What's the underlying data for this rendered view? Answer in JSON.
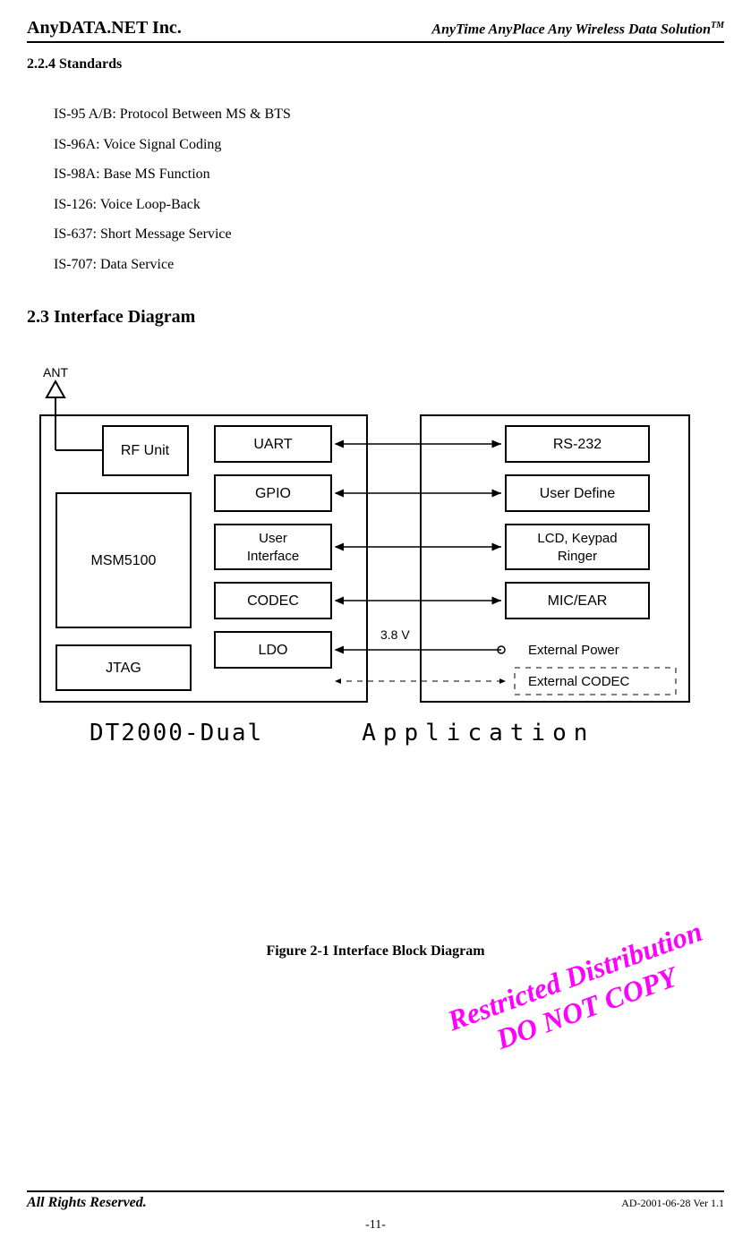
{
  "header": {
    "company": "AnyDATA.NET Inc.",
    "tagline": "AnyTime AnyPlace Any Wireless Data Solution",
    "tagline_super": "TM"
  },
  "section": {
    "number_title": "2.2.4 Standards",
    "standards": [
      "IS-95 A/B: Protocol Between MS & BTS",
      "IS-96A: Voice Signal Coding",
      "IS-98A: Base MS Function",
      "IS-126: Voice Loop-Back",
      "IS-637: Short Message Service",
      "IS-707: Data Service"
    ]
  },
  "main_heading": "2.3 Interface Diagram",
  "diagram": {
    "ant_label": "ANT",
    "left_panel_label": "DT2000-Dual",
    "right_panel_label": "Application",
    "left_blocks": {
      "rf_unit": "RF Unit",
      "msm5100": "MSM5100",
      "jtag": "JTAG",
      "uart": "UART",
      "gpio": "GPIO",
      "user_interface_1": "User",
      "user_interface_2": "Interface",
      "codec": "CODEC",
      "ldo": "LDO"
    },
    "right_blocks": {
      "rs232": "RS-232",
      "user_define": "User Define",
      "lcd_keypad_1": "LCD, Keypad",
      "lcd_keypad_2": "Ringer",
      "mic_ear": "MIC/EAR"
    },
    "voltage": "3.8 V",
    "external_power": "External Power",
    "external_codec": "External CODEC"
  },
  "figure_caption": "Figure 2-1 Interface Block Diagram",
  "watermark": {
    "line1": "Restricted Distribution",
    "line2": "DO NOT COPY"
  },
  "footer": {
    "left": "All Rights Reserved.",
    "right": "AD-2001-06-28 Ver 1.1",
    "page": "-11-"
  }
}
